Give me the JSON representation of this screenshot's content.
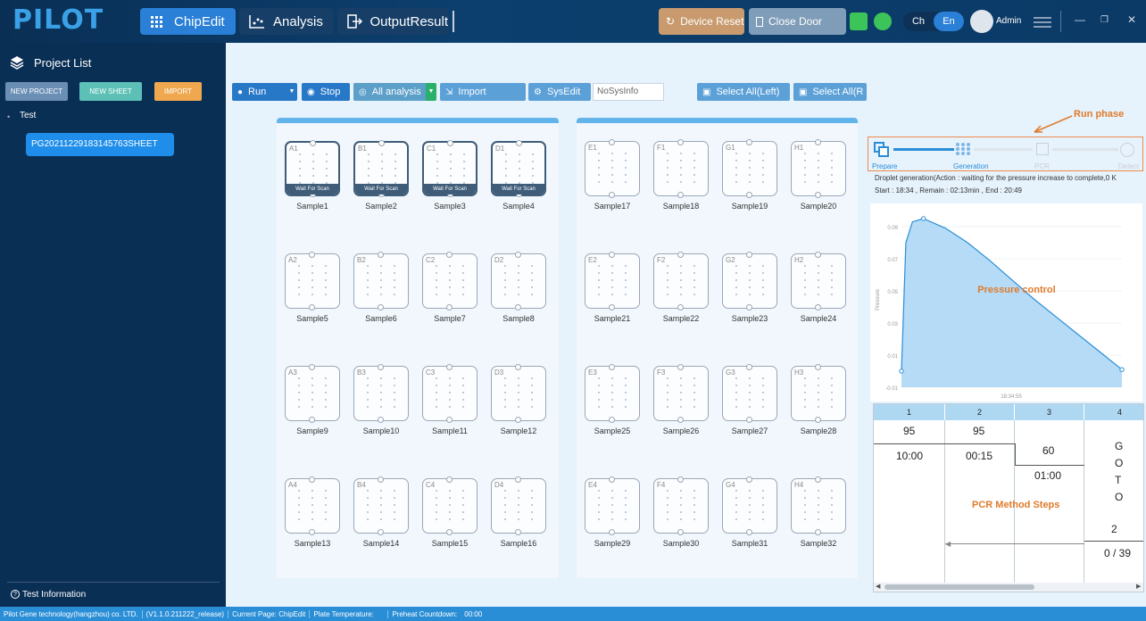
{
  "app": {
    "logo": "PILOT"
  },
  "nav": {
    "tabs": [
      {
        "label": "ChipEdit",
        "icon": "grid-icon"
      },
      {
        "label": "Analysis",
        "icon": "chart-icon"
      },
      {
        "label": "OutputResult",
        "icon": "export-icon"
      }
    ]
  },
  "header": {
    "device_reset": "Device Reset",
    "close_door": "Close Door",
    "lang": [
      "Ch",
      "En"
    ],
    "user": "Admin",
    "colors": {
      "device_reset": "#c89a6e",
      "close_door": "#7f9db8",
      "status_green": "#3cc45a"
    }
  },
  "sidebar": {
    "title": "Project List",
    "buttons": [
      "NEW PROJECT",
      "NEW SHEET",
      "IMPORT"
    ],
    "tree": {
      "project": "Test",
      "sheet": "PG20211229183145763SHEET"
    },
    "footer": "Test Information"
  },
  "toolbar": {
    "run": "Run",
    "stop": "Stop",
    "all_analysis": "All analysis",
    "import": "Import",
    "sysedit": "SysEdit",
    "sysinfo_value": "NoSysInfo",
    "select_left": "Select All(Left)",
    "select_right": "Select All(R"
  },
  "plates": {
    "left": {
      "rows": [
        "A",
        "B",
        "C",
        "D"
      ],
      "cols": [
        "1",
        "2",
        "3",
        "4"
      ]
    },
    "right": {
      "rows": [
        "E",
        "F",
        "G",
        "H"
      ],
      "cols": [
        "1",
        "2",
        "3",
        "4"
      ]
    },
    "wait_for_scan": "Wait For Scan",
    "sample_prefix": "Sample"
  },
  "run_phase": {
    "label": "Run phase",
    "steps": [
      "Prepare",
      "Generation",
      "PCR",
      "Detect"
    ]
  },
  "status": {
    "droplet": "Droplet generation(Action : waiting for the pressure increase to complete,0 K",
    "times": "Start : 18:34 , Remain : 02:13min , End : 20:49"
  },
  "chart_data": {
    "type": "area",
    "title": "",
    "annotation": "Pressure control",
    "ylabel": "Pressure",
    "xlabel": "18:34:55",
    "ytick_labels": [
      "0.09",
      "0.07",
      "0.05",
      "0.03",
      "0.01",
      "-0.01"
    ],
    "ylim": [
      -0.01,
      0.1
    ],
    "x": [
      0,
      0.02,
      0.05,
      0.1,
      0.2,
      0.3,
      0.4,
      0.5,
      0.6,
      0.7,
      0.8,
      0.9,
      1.0
    ],
    "y": [
      0.0,
      0.08,
      0.093,
      0.095,
      0.089,
      0.08,
      0.069,
      0.057,
      0.045,
      0.034,
      0.023,
      0.012,
      0.001
    ],
    "marker_index": [
      0,
      3,
      12
    ]
  },
  "pcr": {
    "title": "PCR Method Steps",
    "headers": [
      "1",
      "2",
      "3",
      "4"
    ],
    "c1": {
      "temp": "95",
      "time": "10:00"
    },
    "c2": {
      "temp": "95",
      "time": "00:15"
    },
    "c3": {
      "temp": "60",
      "time": "01:00"
    },
    "c4": {
      "goto": [
        "G",
        "O",
        "T",
        "O"
      ],
      "target": "2",
      "cycles": "0 / 39"
    }
  },
  "statusbar": {
    "company": "Pilot Gene technology(hangzhou) co. LTD.",
    "version": "(V1.1.0.211222_release)",
    "current_page": "Current Page:  ChipEdit",
    "plate_temp": "Plate Temperature:",
    "countdown_label": "Preheat Countdown:",
    "countdown_value": "00:00"
  }
}
